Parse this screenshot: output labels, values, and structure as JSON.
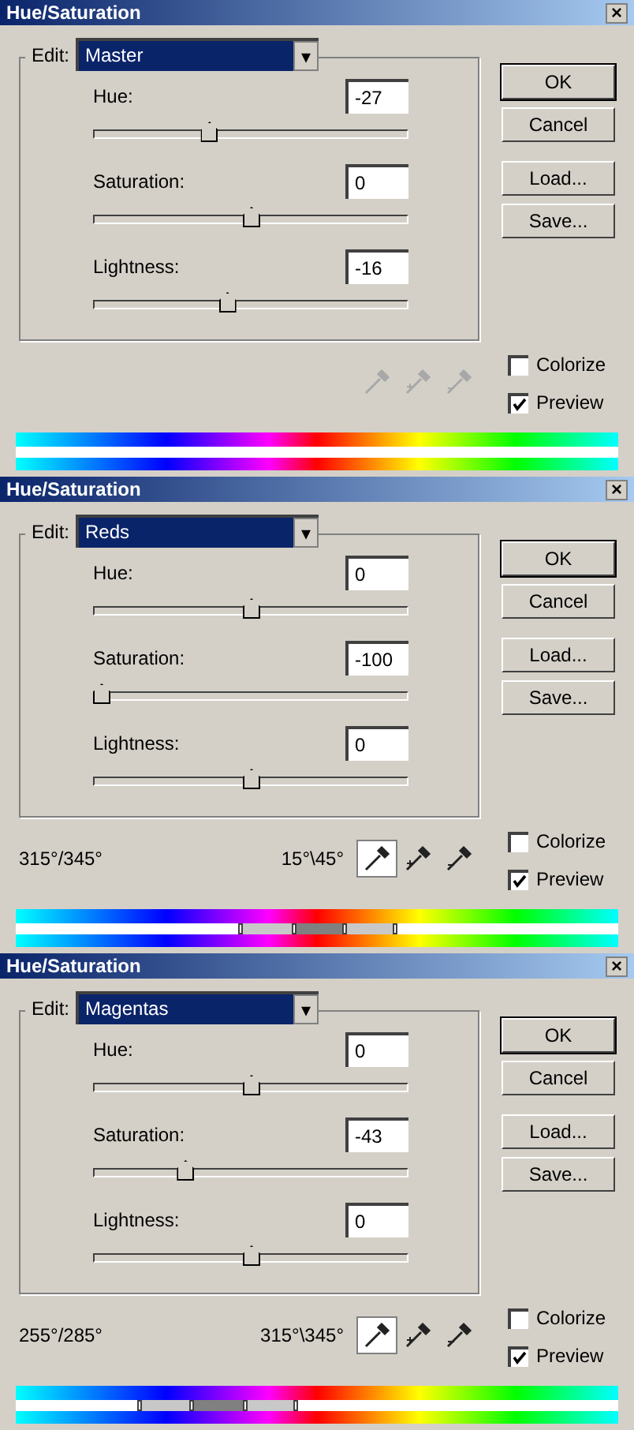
{
  "dialogs": [
    {
      "title": "Hue/Saturation",
      "close": "×",
      "edit_label": "Edit:",
      "edit_value": "Master",
      "dropdown_arrow": "▾",
      "sliders": [
        {
          "label": "Hue:",
          "value": "-27",
          "level": 0.36
        },
        {
          "label": "Saturation:",
          "value": "0",
          "level": 0.5
        },
        {
          "label": "Lightness:",
          "value": "-16",
          "level": 0.42
        }
      ],
      "buttons": [
        "OK",
        "Cancel",
        "Load...",
        "Save..."
      ],
      "eyedroppers": [
        {
          "kind": "plain",
          "selected": false,
          "disabled": true
        },
        {
          "kind": "plus",
          "selected": false,
          "disabled": true
        },
        {
          "kind": "minus",
          "selected": false,
          "disabled": true
        }
      ],
      "checkboxes": [
        {
          "label": "Colorize",
          "checked": false
        },
        {
          "label": "Preview",
          "checked": true
        }
      ]
    },
    {
      "title": "Hue/Saturation",
      "close": "×",
      "edit_label": "Edit:",
      "edit_value": "Reds",
      "dropdown_arrow": "▾",
      "sliders": [
        {
          "label": "Hue:",
          "value": "0",
          "level": 0.5
        },
        {
          "label": "Saturation:",
          "value": "-100",
          "level": 0
        },
        {
          "label": "Lightness:",
          "value": "0",
          "level": 0.5
        }
      ],
      "buttons": [
        "OK",
        "Cancel",
        "Load...",
        "Save..."
      ],
      "range_left": "315°/345°",
      "range_right": "15°\\45°",
      "eyedroppers": [
        {
          "kind": "plain",
          "selected": true,
          "disabled": false
        },
        {
          "kind": "plus",
          "selected": false,
          "disabled": false
        },
        {
          "kind": "minus",
          "selected": false,
          "disabled": false
        }
      ],
      "checkboxes": [
        {
          "label": "Colorize",
          "checked": false
        },
        {
          "label": "Preview",
          "checked": true
        }
      ],
      "range_handles": [
        {
          "level": 0.372
        },
        {
          "level": 0.46
        },
        {
          "level": 0.545
        },
        {
          "level": 0.628
        }
      ]
    },
    {
      "title": "Hue/Saturation",
      "close": "×",
      "edit_label": "Edit:",
      "edit_value": "Magentas",
      "dropdown_arrow": "▾",
      "sliders": [
        {
          "label": "Hue:",
          "value": "0",
          "level": 0.5
        },
        {
          "label": "Saturation:",
          "value": "-43",
          "level": 0.28
        },
        {
          "label": "Lightness:",
          "value": "0",
          "level": 0.5
        }
      ],
      "buttons": [
        "OK",
        "Cancel",
        "Load...",
        "Save..."
      ],
      "range_left": "255°/285°",
      "range_right": "315°\\345°",
      "eyedroppers": [
        {
          "kind": "plain",
          "selected": true,
          "disabled": false
        },
        {
          "kind": "plus",
          "selected": false,
          "disabled": false
        },
        {
          "kind": "minus",
          "selected": false,
          "disabled": false
        }
      ],
      "checkboxes": [
        {
          "label": "Colorize",
          "checked": false
        },
        {
          "label": "Preview",
          "checked": true
        }
      ],
      "range_handles": [
        {
          "level": 0.204
        },
        {
          "level": 0.29
        },
        {
          "level": 0.38
        },
        {
          "level": 0.463
        }
      ]
    }
  ]
}
